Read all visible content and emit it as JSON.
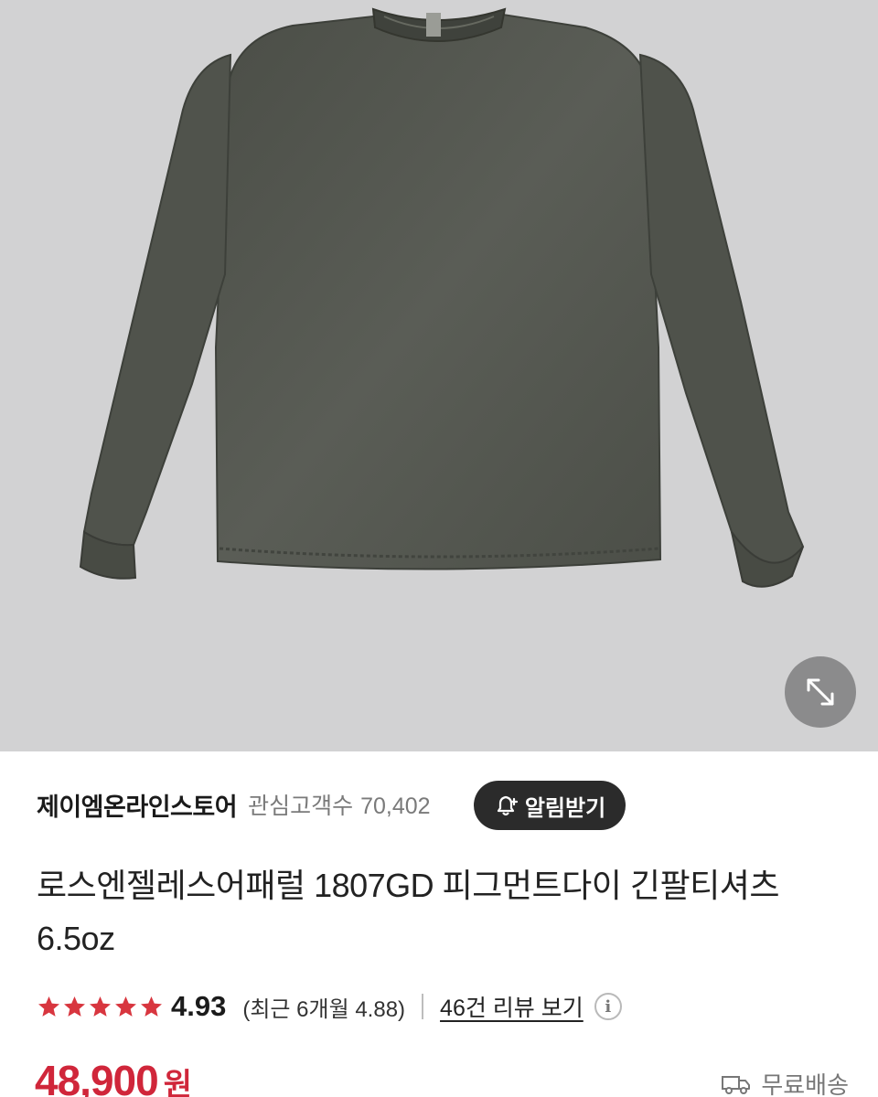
{
  "product": {
    "image_alt": "로스엔젤레스어패럴 1807GD 피그먼트다이 긴팔티셔츠 6.5oz",
    "store_name": "제이엠온라인스토어",
    "followers_label": "관심고객수",
    "followers_count": "70,402",
    "alert_button_label": "알림받기",
    "title": "로스엔젤레스어패럴 1807GD 피그먼트다이 긴팔티셔츠 6.5oz",
    "rating": {
      "stars": 5,
      "score": "4.93",
      "recent": "(최근 6개월 4.88)"
    },
    "reviews_link": "46건 리뷰 보기",
    "price": "48,900",
    "currency": "원",
    "shipping": "무료배송"
  },
  "colors": {
    "price": "#d0263a",
    "star": "#d8363f",
    "hero_bg": "#d2d2d3",
    "shirt": "#54574f"
  },
  "icons": {
    "expand": "expand-arrows-icon",
    "bell": "bell-plus-icon",
    "star": "star-icon",
    "info": "info-icon",
    "truck": "delivery-truck-icon"
  }
}
